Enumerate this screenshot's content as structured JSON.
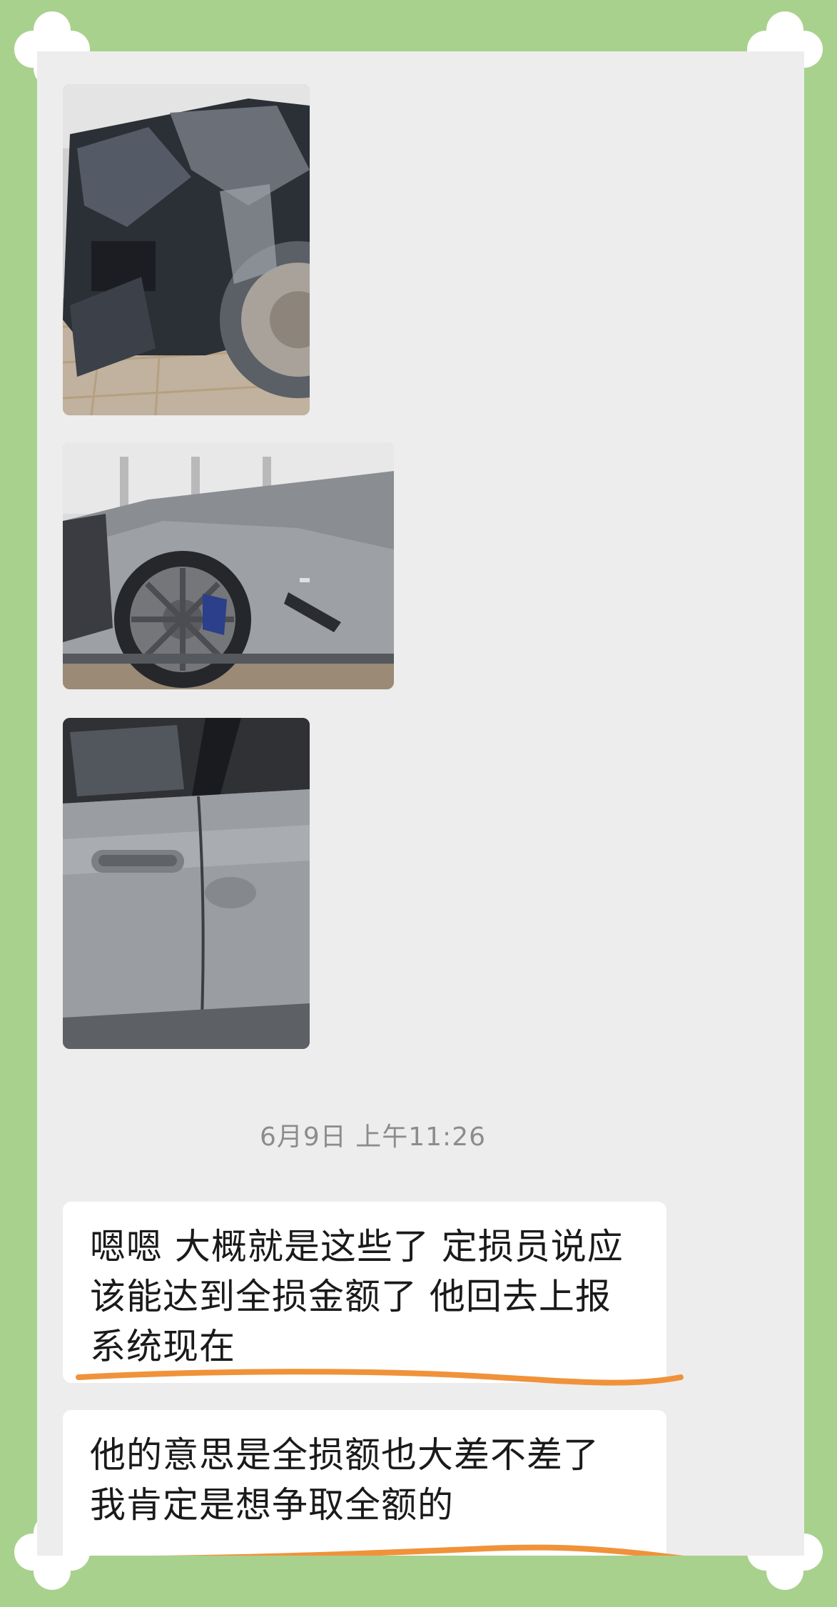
{
  "colors": {
    "frame_green": "#a9d18e",
    "chat_background": "#ededed",
    "bubble_background": "#ffffff",
    "annotation_orange": "#f0923a",
    "timestamp_gray": "#8c8c8c"
  },
  "chat": {
    "images": [
      {
        "name": "damaged-front-end-photo"
      },
      {
        "name": "damaged-fender-wheel-photo"
      },
      {
        "name": "dented-door-photo"
      }
    ],
    "timestamp": "6月9日 上午11:26",
    "messages": [
      {
        "text": "嗯嗯 大概就是这些了 定损员说应该能达到全损金额了 他回去上报系统现在",
        "underlined": true
      },
      {
        "text": "他的意思是全损额也大差不差了 我肯定是想争取全额的",
        "underlined": true
      }
    ]
  }
}
